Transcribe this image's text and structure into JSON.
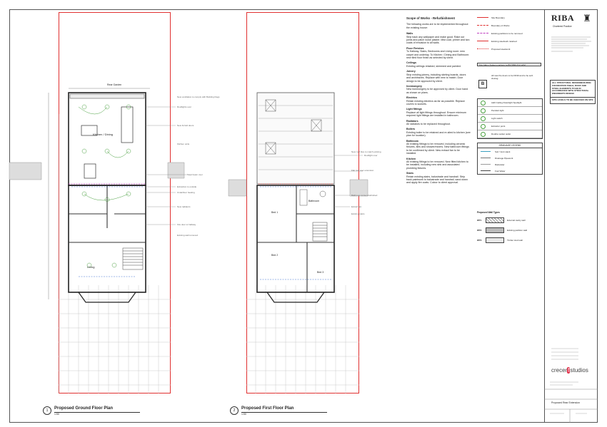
{
  "plans": [
    {
      "number": "1",
      "title": "Proposed Ground Floor Plan",
      "scale": "1:50"
    },
    {
      "number": "2",
      "title": "Proposed First Floor Plan",
      "scale": "1:50"
    }
  ],
  "ground": {
    "top_label": "Rear Garden",
    "room_kitchen": "Kitchen / Dining",
    "room_living": "Living",
    "notes": [
      "New ventilation to comply with Building Regs",
      "Rooflights over",
      "New bi-fold doors",
      "Kitchen units",
      "Steel beam over",
      "Extraction to outside",
      "Underfloor heating",
      "New radiators",
      "Fire door to hallway",
      "Existing wall removed"
    ]
  },
  "first": {
    "rooms": [
      "Bed 1",
      "Bathroom",
      "Bed 2",
      "Bed 3"
    ],
    "notes": [
      "New roof tiles to match existing",
      "Flat roof over extension",
      "Rooflight over",
      "Bathroom to be refurbished",
      "Extract fan",
      "Existing stairs"
    ]
  },
  "scope": {
    "title": "Scope of Works - Refurbishment",
    "intro": "The following works are to be implemented throughout the existing house:",
    "sections": [
      {
        "head": "Walls",
        "body": "Strip back any wallpaper and make good. Rake out joints and patch loose plaster. Mist coat, primer and two coats of emulsion to all walls."
      },
      {
        "head": "Floor Finishes",
        "body": "To Hallway, Stairs, Bedrooms and Living room: new carpet and underlay. To Kitchen / Dining and Bathroom: new tiled floor finish as selected by client."
      },
      {
        "head": "Ceilings",
        "body": "Existing ceilings retained, skimmed and painted."
      },
      {
        "head": "Joinery",
        "body": "Strip existing joinery, including skirting boards, doors and architraves. Replace with new to match. Door design to be approved by client."
      },
      {
        "head": "Ironmongery",
        "body": "New ironmongery to be approved by client. Door hand as shown on plans."
      },
      {
        "head": "Electrics",
        "body": "Retain existing electrics as far as possible. Replace covers to sockets."
      },
      {
        "head": "Light fittings",
        "body": "Replace all light fittings throughout. Ensure minimum required light fittings are installed in bathroom."
      },
      {
        "head": "Radiators",
        "body": "All radiators to be replaced throughout."
      },
      {
        "head": "Boilers",
        "body": "Existing boiler to be retained and re-sited to kitchen (see plan for location)."
      },
      {
        "head": "Bathroom",
        "body": "All existing fittings to be removed, including ceramic fixtures, tiles and shower/mixers. New bathroom fittings to be confirmed by client. New extract fan to be installed."
      },
      {
        "head": "Kitchen",
        "body": "All existing fittings to be removed. New fitted kitchen to be installed, including new sink and associated plumbing fixtures."
      },
      {
        "head": "Stairs",
        "body": "Retain existing stairs, balustrade and handrail. Strip back paintwork to balustrade and handrail, sand down and apply fire coats. Colour to client approval."
      }
    ]
  },
  "legend": {
    "lines": [
      {
        "label": "Site Boundary",
        "color": "#e03030",
        "style": "solid"
      },
      {
        "label": "Boundary of Works",
        "color": "#e03030",
        "style": "dashed"
      },
      {
        "label": "Existing partitions to be removed",
        "color": "#c040c0",
        "style": "dashed"
      },
      {
        "label": "Existing steelwork retained",
        "color": "#e03030",
        "style": "solid"
      },
      {
        "label": "Proposed steelwork",
        "color": "#e03030",
        "style": "dotted"
      }
    ],
    "note": "Fire Alarm System conform to BS 5839 Pt1 L2/M",
    "fire_note": "All new fire doors to be FD30 and to be self-closing.",
    "symbols": [
      {
        "code": "",
        "label": "LED Ceiling Downlight Spotlight"
      },
      {
        "code": "",
        "label": "Pendant light"
      },
      {
        "code": "",
        "label": "Light switch"
      },
      {
        "code": "",
        "label": "Extractor point"
      },
      {
        "code": "",
        "label": "Double socket outlet"
      }
    ],
    "drainage_title": "DRAINAGE LEGEND",
    "drainage": [
      {
        "label": "Soil / Vent stack",
        "color": "#3aa0c0"
      },
      {
        "label": "Drainage Pipework",
        "color": "#777"
      },
      {
        "label": "Rainwater",
        "color": "#9b9b9b"
      },
      {
        "label": "Foul Water",
        "color": "#444"
      }
    ],
    "wall_types_title": "Proposed Wall Types",
    "wall_types": [
      {
        "code": "WT1",
        "label": "External cavity wall"
      },
      {
        "code": "WT2",
        "label": "Existing partition wall"
      },
      {
        "code": "WT3",
        "label": "Timber stud wall"
      }
    ]
  },
  "titleblock": {
    "riba": "RIBA",
    "riba_sub": "Chartered Practice",
    "warnings": [
      "ALL STRUCTURAL DESIGN/BUILDING FOUNDATION TABLE, ROOF AND STEEL ELEMENTS TO BE IN ACCORDANCE WITH STRUCTURAL ENGINEER'S DESIGN",
      "SITE LEVELS TO BE CHECKED ON SITE"
    ],
    "logo_left": "crecer",
    "logo_mid": "f",
    "logo_right": "studios",
    "project": "Proposed Rear Extension"
  }
}
